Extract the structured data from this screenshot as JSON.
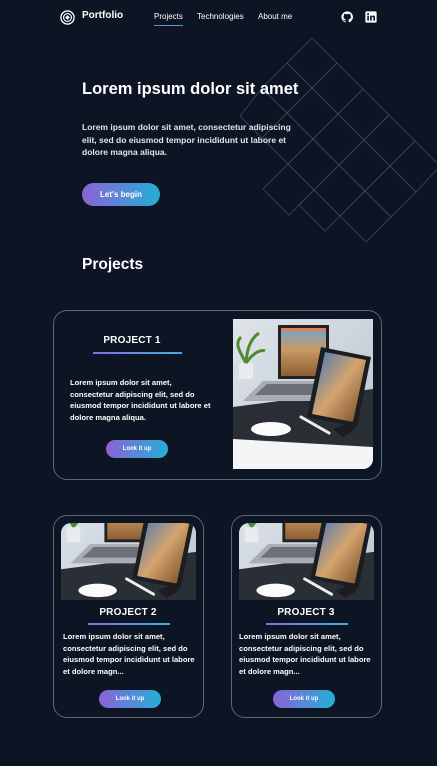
{
  "header": {
    "logo_text": "Portfolio",
    "nav": [
      {
        "label": "Projects",
        "active": true
      },
      {
        "label": "Technologies",
        "active": false
      },
      {
        "label": "About me",
        "active": false
      }
    ],
    "social_icons": [
      "github-icon",
      "linkedin-icon"
    ]
  },
  "hero": {
    "title": "Lorem ipsum dolor sit amet",
    "text": "Lorem ipsum dolor sit amet, consectetur adipiscing elit, sed do eiusmod tempor incididunt ut labore et dolore magna aliqua.",
    "button": "Let's begin"
  },
  "projects": {
    "section_title": "Projects",
    "items": [
      {
        "title": "PROJECT 1",
        "text": "Lorem ipsum dolor sit amet, consectetur adipiscing elit, sed do eiusmod tempor incididunt ut labore et dolore magna aliqua.",
        "button": "Look it up"
      },
      {
        "title": "PROJECT 2",
        "text": "Lorem ipsum dolor sit amet, consectetur adipiscing elit, sed do eiusmod tempor incididunt ut labore et dolore magn...",
        "button": "Look it up"
      },
      {
        "title": "PROJECT 3",
        "text": "Lorem ipsum dolor sit amet, consectetur adipiscing elit, sed do eiusmod tempor incididunt ut labore et dolore magn...",
        "button": "Look it up"
      }
    ]
  },
  "colors": {
    "background": "#0d1424",
    "gradient_start": "#8a63d6",
    "gradient_end": "#25aed6",
    "card_border": "#5d6473"
  }
}
